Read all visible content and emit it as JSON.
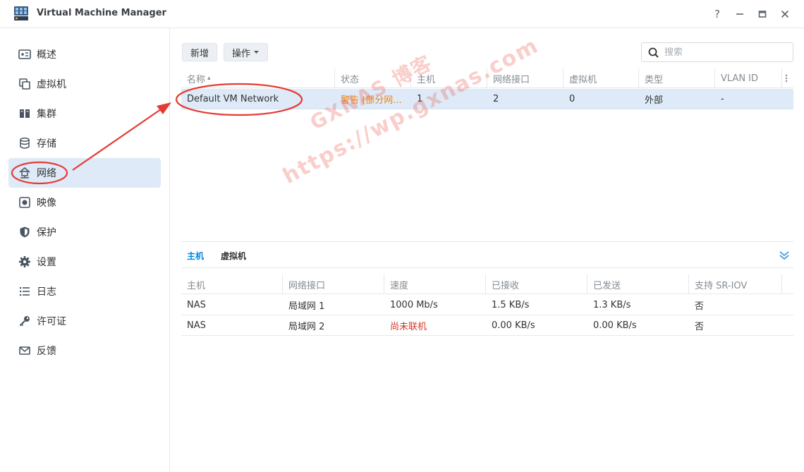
{
  "window": {
    "title": "Virtual Machine Manager",
    "controls": {
      "help": "?",
      "minimize": "—",
      "maximize": "▭",
      "close": "✕"
    }
  },
  "sidebar": {
    "items": [
      {
        "label": "概述",
        "icon": "overview-icon"
      },
      {
        "label": "虚拟机",
        "icon": "virtual-machine-icon"
      },
      {
        "label": "集群",
        "icon": "cluster-icon"
      },
      {
        "label": "存储",
        "icon": "storage-icon"
      },
      {
        "label": "网络",
        "icon": "network-icon",
        "active": true
      },
      {
        "label": "映像",
        "icon": "image-icon"
      },
      {
        "label": "保护",
        "icon": "shield-icon"
      },
      {
        "label": "设置",
        "icon": "gear-icon"
      },
      {
        "label": "日志",
        "icon": "log-list-icon"
      },
      {
        "label": "许可证",
        "icon": "key-icon"
      },
      {
        "label": "反馈",
        "icon": "envelope-icon"
      }
    ]
  },
  "toolbar": {
    "add_label": "新增",
    "actions_label": "操作",
    "search_placeholder": "搜索"
  },
  "network_table": {
    "columns": [
      "名称",
      "状态",
      "主机",
      "网络接口",
      "虚拟机",
      "类型",
      "VLAN ID"
    ],
    "sort_indicator": "▴",
    "rows": [
      {
        "name": "Default VM Network",
        "status": "警告 (部分网...",
        "hosts": "1",
        "interfaces": "2",
        "vms": "0",
        "type": "外部",
        "vlan": "-"
      }
    ]
  },
  "detail_tabs": [
    "主机",
    "虚拟机"
  ],
  "host_table": {
    "columns": [
      "主机",
      "网络接口",
      "速度",
      "已接收",
      "已发送",
      "支持 SR-IOV"
    ],
    "rows": [
      {
        "host": "NAS",
        "interface": "局域网 1",
        "speed": "1000 Mb/s",
        "received": "1.5 KB/s",
        "sent": "1.3 KB/s",
        "sriov": "否"
      },
      {
        "host": "NAS",
        "interface": "局域网 2",
        "speed": "尚未联机",
        "received": "0.00 KB/s",
        "sent": "0.00 KB/s",
        "sriov": "否"
      }
    ]
  },
  "watermark": {
    "line1": "GXNAS 博客",
    "line2": "https://wp.gxnas.com"
  },
  "colors": {
    "accent": "#0086e5",
    "selected_row": "#deeaf7",
    "warning": "#e8871e",
    "error": "#d0392b",
    "annotation": "#e53b35"
  }
}
